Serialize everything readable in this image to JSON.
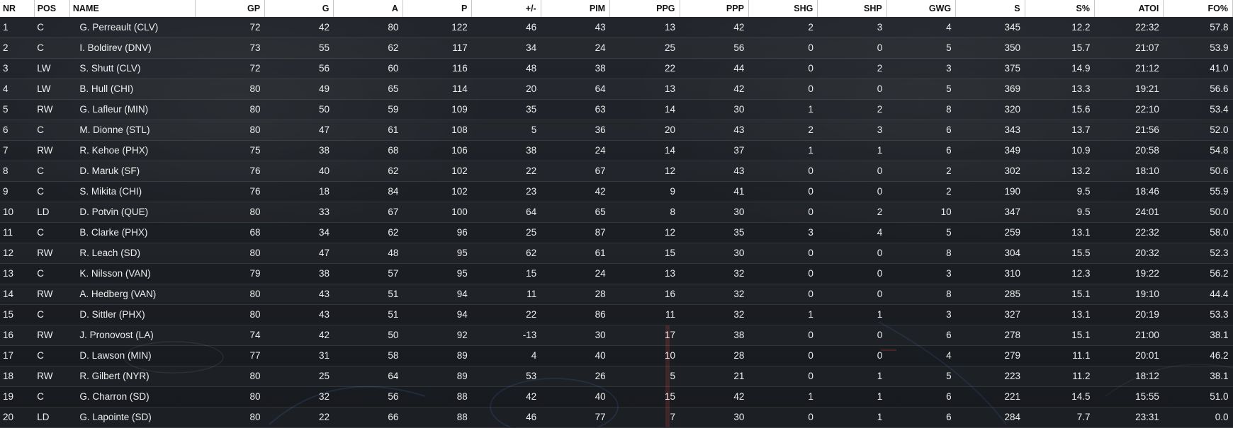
{
  "table": {
    "columns": [
      "NR",
      "POS",
      "NAME",
      "GP",
      "G",
      "A",
      "P",
      "+/-",
      "PIM",
      "PPG",
      "PPP",
      "SHG",
      "SHP",
      "GWG",
      "S",
      "S%",
      "ATOI",
      "FO%"
    ],
    "rows": [
      [
        "1",
        "C",
        "G. Perreault (CLV)",
        "72",
        "42",
        "80",
        "122",
        "46",
        "43",
        "13",
        "42",
        "2",
        "3",
        "4",
        "345",
        "12.2",
        "22:32",
        "57.8"
      ],
      [
        "2",
        "C",
        "I. Boldirev (DNV)",
        "73",
        "55",
        "62",
        "117",
        "34",
        "24",
        "25",
        "56",
        "0",
        "0",
        "5",
        "350",
        "15.7",
        "21:07",
        "53.9"
      ],
      [
        "3",
        "LW",
        "S. Shutt (CLV)",
        "72",
        "56",
        "60",
        "116",
        "48",
        "38",
        "22",
        "44",
        "0",
        "2",
        "3",
        "375",
        "14.9",
        "21:12",
        "41.0"
      ],
      [
        "4",
        "LW",
        "B. Hull (CHI)",
        "80",
        "49",
        "65",
        "114",
        "20",
        "64",
        "13",
        "42",
        "0",
        "0",
        "5",
        "369",
        "13.3",
        "19:21",
        "56.6"
      ],
      [
        "5",
        "RW",
        "G. Lafleur (MIN)",
        "80",
        "50",
        "59",
        "109",
        "35",
        "63",
        "14",
        "30",
        "1",
        "2",
        "8",
        "320",
        "15.6",
        "22:10",
        "53.4"
      ],
      [
        "6",
        "C",
        "M. Dionne (STL)",
        "80",
        "47",
        "61",
        "108",
        "5",
        "36",
        "20",
        "43",
        "2",
        "3",
        "6",
        "343",
        "13.7",
        "21:56",
        "52.0"
      ],
      [
        "7",
        "RW",
        "R. Kehoe (PHX)",
        "75",
        "38",
        "68",
        "106",
        "38",
        "24",
        "14",
        "37",
        "1",
        "1",
        "6",
        "349",
        "10.9",
        "20:58",
        "54.8"
      ],
      [
        "8",
        "C",
        "D. Maruk (SF)",
        "76",
        "40",
        "62",
        "102",
        "22",
        "67",
        "12",
        "43",
        "0",
        "0",
        "2",
        "302",
        "13.2",
        "18:10",
        "50.6"
      ],
      [
        "9",
        "C",
        "S. Mikita (CHI)",
        "76",
        "18",
        "84",
        "102",
        "23",
        "42",
        "9",
        "41",
        "0",
        "0",
        "2",
        "190",
        "9.5",
        "18:46",
        "55.9"
      ],
      [
        "10",
        "LD",
        "D. Potvin (QUE)",
        "80",
        "33",
        "67",
        "100",
        "64",
        "65",
        "8",
        "30",
        "0",
        "2",
        "10",
        "347",
        "9.5",
        "24:01",
        "50.0"
      ],
      [
        "11",
        "C",
        "B. Clarke (PHX)",
        "68",
        "34",
        "62",
        "96",
        "25",
        "87",
        "12",
        "35",
        "3",
        "4",
        "5",
        "259",
        "13.1",
        "22:32",
        "58.0"
      ],
      [
        "12",
        "RW",
        "R. Leach (SD)",
        "80",
        "47",
        "48",
        "95",
        "62",
        "61",
        "15",
        "30",
        "0",
        "0",
        "8",
        "304",
        "15.5",
        "20:32",
        "52.3"
      ],
      [
        "13",
        "C",
        "K. Nilsson (VAN)",
        "79",
        "38",
        "57",
        "95",
        "15",
        "24",
        "13",
        "32",
        "0",
        "0",
        "3",
        "310",
        "12.3",
        "19:22",
        "56.2"
      ],
      [
        "14",
        "RW",
        "A. Hedberg (VAN)",
        "80",
        "43",
        "51",
        "94",
        "11",
        "28",
        "16",
        "32",
        "0",
        "0",
        "8",
        "285",
        "15.1",
        "19:10",
        "44.4"
      ],
      [
        "15",
        "C",
        "D. Sittler (PHX)",
        "80",
        "43",
        "51",
        "94",
        "22",
        "86",
        "11",
        "32",
        "1",
        "1",
        "3",
        "327",
        "13.1",
        "20:19",
        "53.3"
      ],
      [
        "16",
        "RW",
        "J. Pronovost (LA)",
        "74",
        "42",
        "50",
        "92",
        "-13",
        "30",
        "17",
        "38",
        "0",
        "0",
        "6",
        "278",
        "15.1",
        "21:00",
        "38.1"
      ],
      [
        "17",
        "C",
        "D. Lawson (MIN)",
        "77",
        "31",
        "58",
        "89",
        "4",
        "40",
        "10",
        "28",
        "0",
        "0",
        "4",
        "279",
        "11.1",
        "20:01",
        "46.2"
      ],
      [
        "18",
        "RW",
        "R. Gilbert (NYR)",
        "80",
        "25",
        "64",
        "89",
        "53",
        "26",
        "5",
        "21",
        "0",
        "1",
        "5",
        "223",
        "11.2",
        "18:12",
        "38.1"
      ],
      [
        "19",
        "C",
        "G. Charron (SD)",
        "80",
        "32",
        "56",
        "88",
        "42",
        "40",
        "15",
        "42",
        "1",
        "1",
        "6",
        "221",
        "14.5",
        "15:55",
        "51.0"
      ],
      [
        "20",
        "LD",
        "G. Lapointe (SD)",
        "80",
        "22",
        "66",
        "88",
        "46",
        "77",
        "7",
        "30",
        "0",
        "1",
        "6",
        "284",
        "7.7",
        "23:31",
        "0.0"
      ]
    ]
  }
}
